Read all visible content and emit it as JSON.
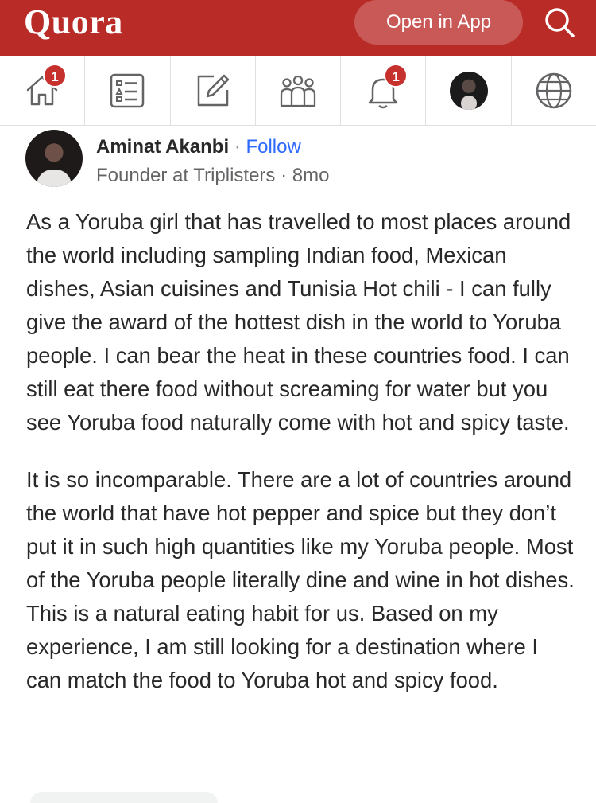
{
  "header": {
    "logo": "Quora",
    "open_app_label": "Open in App",
    "search_icon": "search-icon",
    "brand_color": "#b92b27"
  },
  "nav": {
    "items": [
      {
        "name": "home",
        "icon": "home-icon",
        "badge": "1"
      },
      {
        "name": "following",
        "icon": "list-icon",
        "badge": ""
      },
      {
        "name": "answer",
        "icon": "pencil-edit-icon",
        "badge": ""
      },
      {
        "name": "spaces",
        "icon": "people-group-icon",
        "badge": ""
      },
      {
        "name": "notifications",
        "icon": "bell-icon",
        "badge": "1"
      },
      {
        "name": "profile",
        "icon": "avatar",
        "badge": ""
      },
      {
        "name": "languages",
        "icon": "globe-icon",
        "badge": ""
      }
    ],
    "badge_color": "#c7312d"
  },
  "post": {
    "author_name": "Aminat Akanbi",
    "separator": " · ",
    "follow_label": "Follow",
    "credential": "Founder at Triplisters · 8mo",
    "paragraphs": [
      "As a Yoruba girl that has travelled to most places around the world including sampling Indian food, Mexican dishes, Asian cuisines and Tunisia Hot chili - I can fully give the award of the hottest dish in the world to Yoruba people. I can bear the heat in these countries food. I can still eat there food without screaming for water but you see Yoruba food naturally come with hot and spicy taste.",
      "It is so incomparable. There are a lot of countries around the world that have hot pepper and spice but they don’t put it in such high quantities like my Yoruba people. Most of the Yoruba people literally dine and wine in hot dishes. This is a natural eating habit for us. Based on my experience, I am still looking for a destination where I can match the food to Yoruba hot and spicy food."
    ],
    "link_color": "#2e69ff"
  }
}
